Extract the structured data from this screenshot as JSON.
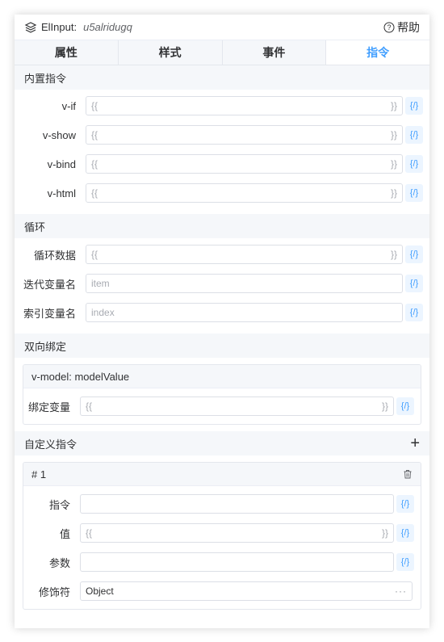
{
  "header": {
    "component_name": "ElInput:",
    "component_id": "u5alridugq",
    "help_label": "帮助"
  },
  "tabs": [
    {
      "label": "属性"
    },
    {
      "label": "样式"
    },
    {
      "label": "事件"
    },
    {
      "label": "指令"
    }
  ],
  "active_tab": "指令",
  "builtin": {
    "title": "内置指令",
    "rows": [
      {
        "label": "v-if",
        "value": "{{",
        "suffix": "}}"
      },
      {
        "label": "v-show",
        "value": "{{",
        "suffix": "}}"
      },
      {
        "label": "v-bind",
        "value": "{{",
        "suffix": "}}"
      },
      {
        "label": "v-html",
        "value": "{{",
        "suffix": "}}"
      }
    ]
  },
  "loop": {
    "title": "循环",
    "data_label": "循环数据",
    "data_value": "{{",
    "data_suffix": "}}",
    "item_label": "迭代变量名",
    "item_placeholder": "item",
    "index_label": "索引变量名",
    "index_placeholder": "index"
  },
  "binding": {
    "title": "双向绑定",
    "model_header": "v-model: modelValue",
    "var_label": "绑定变量",
    "var_value": "{{",
    "var_suffix": "}}"
  },
  "custom": {
    "title": "自定义指令",
    "add_icon": "plus-icon",
    "item_header": "# 1",
    "directive_label": "指令",
    "value_label": "值",
    "value_value": "{{",
    "value_suffix": "}}",
    "arg_label": "参数",
    "modifiers_label": "修饰符",
    "modifiers_value": "Object",
    "modifiers_more": "···"
  },
  "expr_button_label": "{/}",
  "colors": {
    "accent": "#409eff",
    "section_bg": "#f5f7fa",
    "border": "#dcdfe6"
  }
}
